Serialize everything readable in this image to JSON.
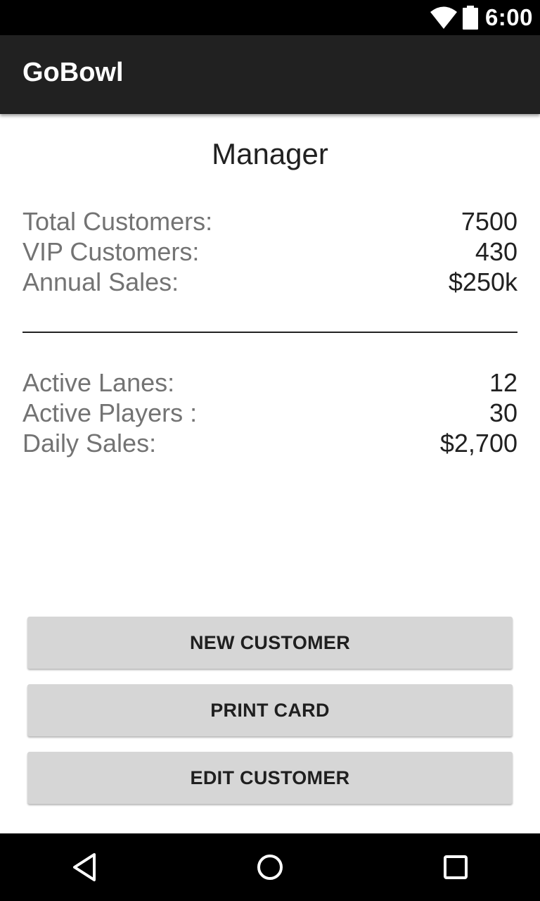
{
  "status_bar": {
    "time": "6:00",
    "icons": [
      "wifi-icon",
      "battery-icon"
    ]
  },
  "app_bar": {
    "title": "GoBowl",
    "background": "#212121"
  },
  "page": {
    "title": "Manager"
  },
  "annual_stats": [
    {
      "label": "Total Customers:",
      "value": "7500"
    },
    {
      "label": "VIP Customers:",
      "value": "430"
    },
    {
      "label": "Annual Sales:",
      "value": "$250k"
    }
  ],
  "daily_stats": [
    {
      "label": "Active Lanes:",
      "value": "12"
    },
    {
      "label": "Active Players :",
      "value": "30"
    },
    {
      "label": "Daily Sales:",
      "value": "$2,700"
    }
  ],
  "buttons": {
    "new_customer": "NEW CUSTOMER",
    "print_card": "PRINT CARD",
    "edit_customer": "EDIT CUSTOMER"
  },
  "nav_bar": {
    "icons": [
      "back-icon",
      "home-icon",
      "recent-apps-icon"
    ]
  }
}
